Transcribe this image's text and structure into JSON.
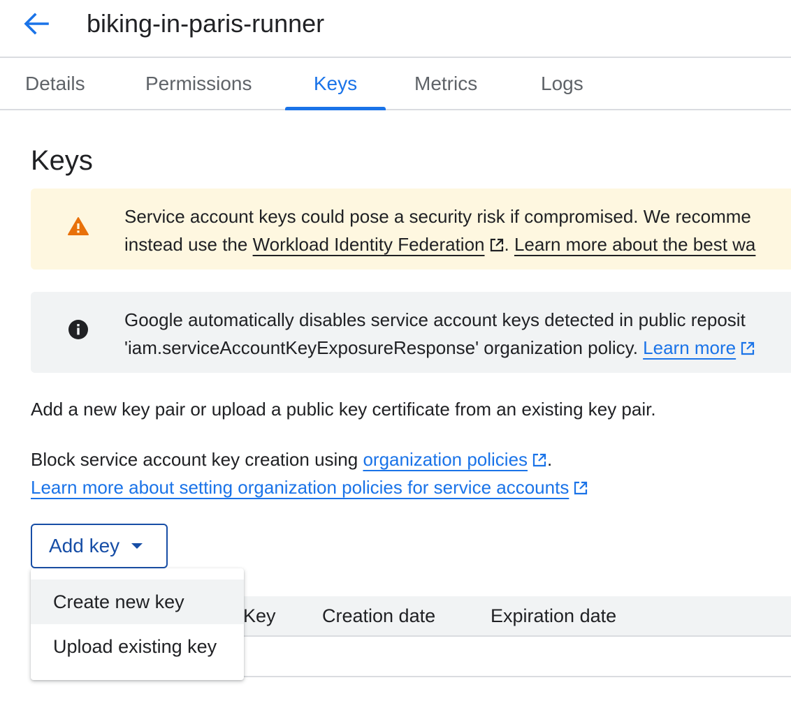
{
  "header": {
    "back_icon": "arrow-back-icon",
    "title": "biking-in-paris-runner"
  },
  "tabs": [
    {
      "label": "Details",
      "active": false
    },
    {
      "label": "Permissions",
      "active": false
    },
    {
      "label": "Keys",
      "active": true
    },
    {
      "label": "Metrics",
      "active": false
    },
    {
      "label": "Logs",
      "active": false
    }
  ],
  "section_title": "Keys",
  "warning_banner": {
    "icon": "warning-icon",
    "line1": "Service account keys could pose a security risk if compromised. We recomme",
    "line2_prefix": "instead use the ",
    "link1": "Workload Identity Federation",
    "line2_mid": ". ",
    "link2": "Learn more about the best wa"
  },
  "info_banner": {
    "icon": "info-icon",
    "line1": "Google automatically disables service account keys detected in public reposit",
    "line2_prefix": "'iam.serviceAccountKeyExposureResponse' organization policy. ",
    "link": "Learn more"
  },
  "description": "Add a new key pair or upload a public key certificate from an existing key pair.",
  "block_text": {
    "prefix": "Block service account key creation using ",
    "link": "organization policies",
    "suffix": "."
  },
  "learn_more_link": "Learn more about setting organization policies for service accounts",
  "add_key_button": "Add key",
  "add_key_menu": [
    "Create new key",
    "Upload existing key"
  ],
  "table": {
    "columns": [
      "Key",
      "Creation date",
      "Expiration date"
    ]
  },
  "colors": {
    "accent": "#1a73e8",
    "button_border": "#174ea6",
    "warning_bg": "#fef7e0",
    "warning_icon": "#e8710a",
    "info_bg": "#f1f3f4"
  }
}
